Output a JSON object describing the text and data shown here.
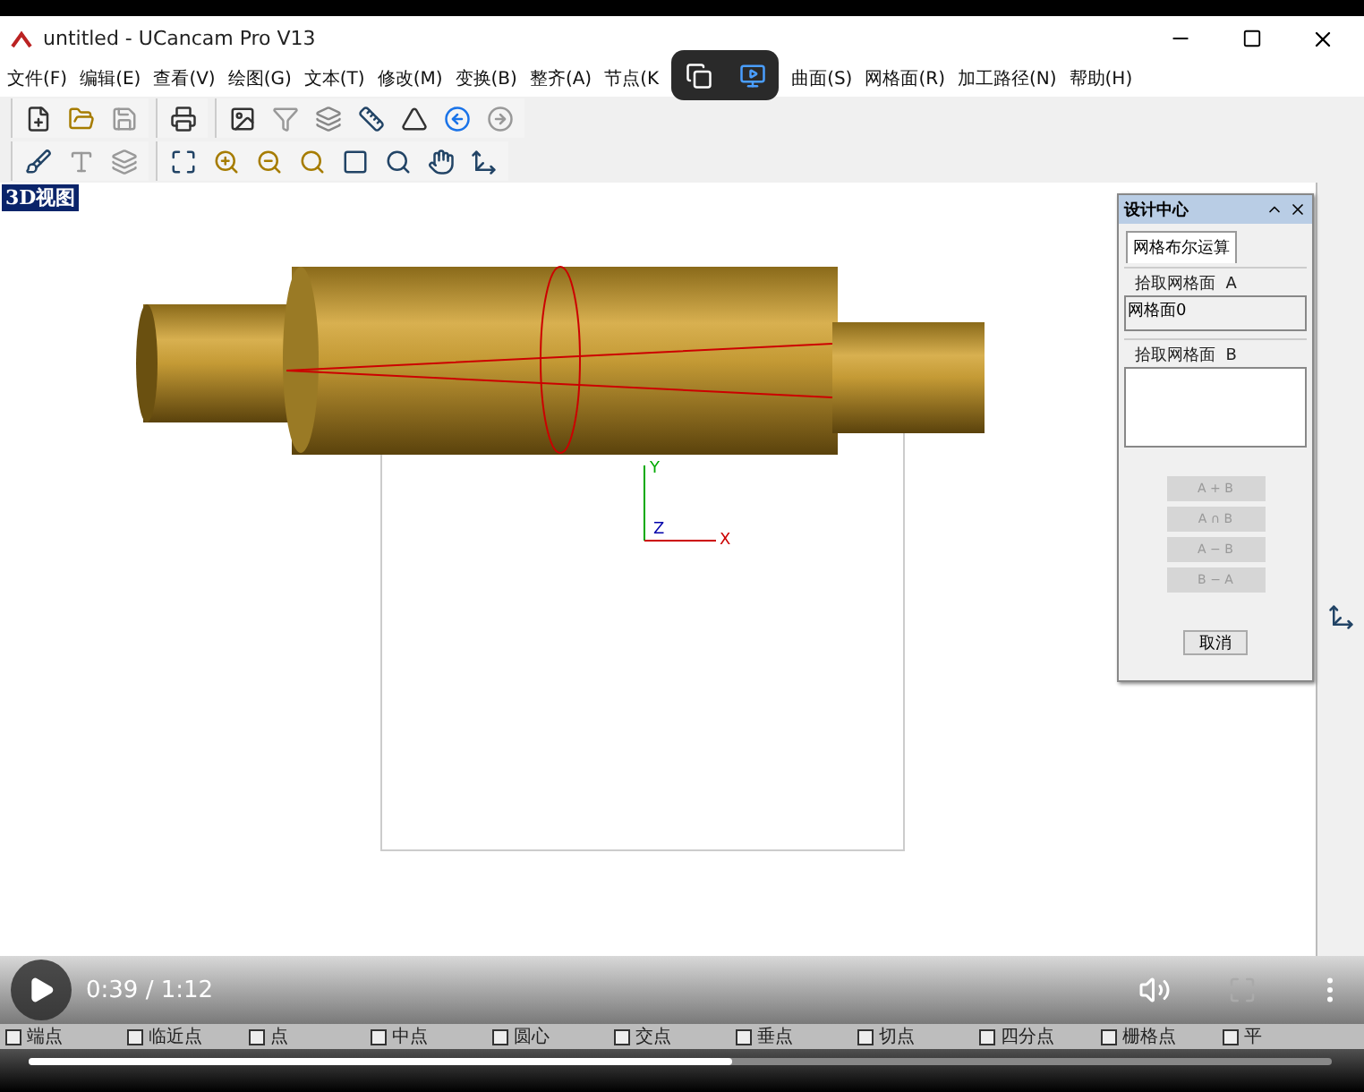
{
  "window": {
    "title": "untitled - UCancam Pro V13"
  },
  "menu": [
    "文件(F)",
    "编辑(E)",
    "查看(V)",
    "绘图(G)",
    "文本(T)",
    "修改(M)",
    "变换(B)",
    "整齐(A)",
    "节点(K",
    "曲面(S)",
    "网格面(R)",
    "加工路径(N)",
    "帮助(H)"
  ],
  "view": {
    "label": "3D视图"
  },
  "axes": {
    "x": "X",
    "y": "Y",
    "z": "Z"
  },
  "panel": {
    "title": "设计中心",
    "tabs": [
      {
        "label": "网格布尔运算",
        "selected": true
      }
    ],
    "group_a": {
      "label": "拾取网格面  A",
      "value": "网格面0"
    },
    "group_b": {
      "label": "拾取网格面  B"
    },
    "operations": [
      {
        "label": "A + B",
        "disabled": true
      },
      {
        "label": "A ∩ B",
        "disabled": true
      },
      {
        "label": "A − B",
        "disabled": true
      },
      {
        "label": "B − A",
        "disabled": true
      }
    ],
    "cancel": "取消"
  },
  "snaps": [
    {
      "label": "端点",
      "checked": false
    },
    {
      "label": "临近点",
      "checked": false
    },
    {
      "label": "点",
      "checked": false
    },
    {
      "label": "中点",
      "checked": false
    },
    {
      "label": "圆心",
      "checked": false
    },
    {
      "label": "交点",
      "checked": false
    },
    {
      "label": "垂点",
      "checked": false
    },
    {
      "label": "切点",
      "checked": false
    },
    {
      "label": "四分点",
      "checked": false
    },
    {
      "label": "栅格点",
      "checked": false
    },
    {
      "label": "平",
      "checked": false
    }
  ],
  "player": {
    "time": "0:39 / 1:12",
    "level": 0.54
  }
}
